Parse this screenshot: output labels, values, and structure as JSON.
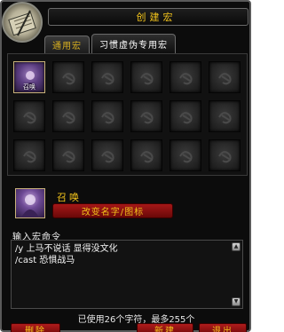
{
  "window": {
    "title": "创建宏"
  },
  "tabs": [
    {
      "label": "通用宏",
      "active": false
    },
    {
      "label": "习惯虚伪专用宏",
      "active": true
    }
  ],
  "slots": {
    "filled": [
      {
        "label": "召唤",
        "icon": "summon-mount-icon"
      }
    ],
    "empty_icon": "empty-slot-icon"
  },
  "selected_macro": {
    "name": "召唤",
    "icon": "summon-mount-icon",
    "change_button_label": "改变名字/图标"
  },
  "editor": {
    "label": "输入宏命令",
    "lines": [
      "/y 上马不说话 显得没文化",
      "/cast 恐惧战马"
    ]
  },
  "char_count_text": "已使用26个字符，最多255个",
  "buttons": {
    "delete": "删除",
    "new": "新建",
    "exit": "退出"
  },
  "colors": {
    "title_gold": "#f2c31b",
    "button_red": "#a51818",
    "panel_bg": "#0c0c0c"
  }
}
